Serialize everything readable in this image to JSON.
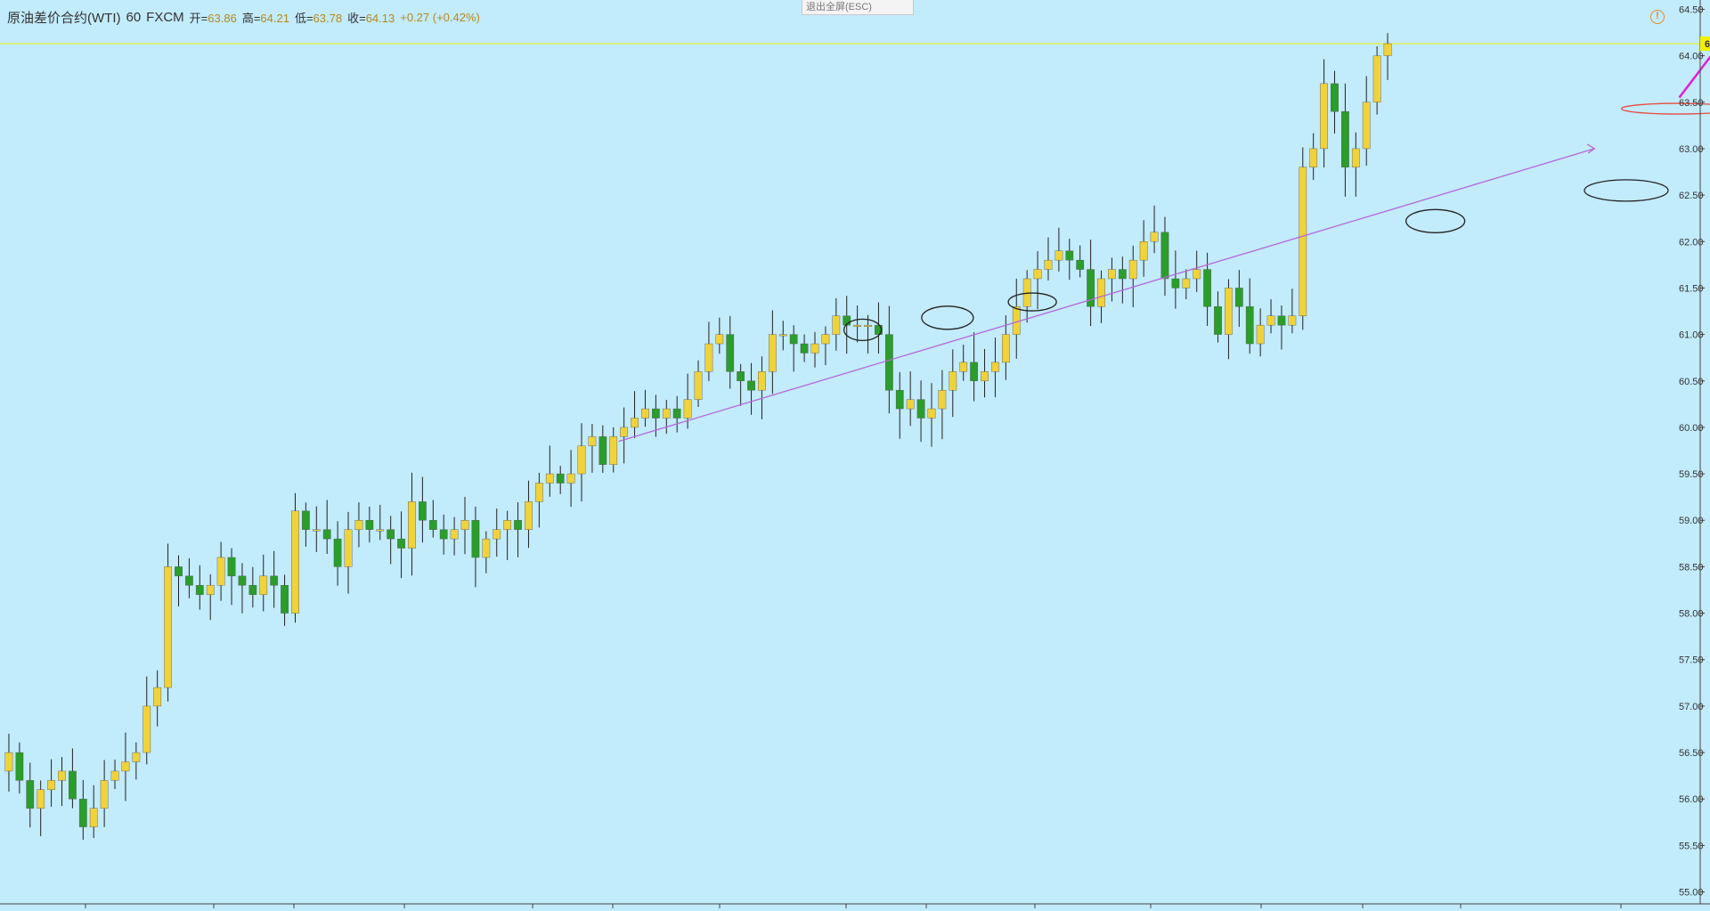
{
  "header": {
    "symbol": "原油差价合约(WTI)",
    "interval": "60",
    "exchange": "FXCM",
    "open_label": "开=",
    "open_value": "63.86",
    "high_label": "高=",
    "high_value": "64.21",
    "low_label": "低=",
    "low_value": "63.78",
    "close_label": "收=",
    "close_value": "64.13",
    "change": "+0.27 (+0.42%)"
  },
  "toolbar": {
    "exit_fullscreen": "退出全屏(ESC)"
  },
  "icons": {
    "alert": "warning-circle-icon"
  },
  "chart_data": {
    "type": "candlestick",
    "ylim": [
      54.9,
      64.6
    ],
    "y_ticks": [
      "64.50",
      "64.00",
      "63.50",
      "63.00",
      "62.50",
      "62.00",
      "61.50",
      "61.00",
      "60.50",
      "60.00",
      "59.50",
      "59.00",
      "58.50",
      "58.00",
      "57.50",
      "57.00",
      "56.50",
      "56.00",
      "55.50",
      "55.00"
    ],
    "last_price": "64.13",
    "colors": {
      "up": "#f0d23a",
      "down": "#2a9d2a",
      "wick": "#222222",
      "last_price_line": "#f3f000",
      "trendline": "#b667d8",
      "annotation_arrow": "#e51bd8",
      "circle": "#222222",
      "red_ellipse": "#e74c3c"
    },
    "closes": [
      56.5,
      56.2,
      55.9,
      56.1,
      56.2,
      56.3,
      56.0,
      55.7,
      55.9,
      56.2,
      56.3,
      56.4,
      56.5,
      57.0,
      57.2,
      58.5,
      58.4,
      58.3,
      58.2,
      58.3,
      58.6,
      58.4,
      58.3,
      58.2,
      58.4,
      58.3,
      58.0,
      59.1,
      58.9,
      58.9,
      58.8,
      58.5,
      58.9,
      59.0,
      58.9,
      58.9,
      58.8,
      58.7,
      59.2,
      59.0,
      58.9,
      58.8,
      58.9,
      59.0,
      58.6,
      58.8,
      58.9,
      59.0,
      58.9,
      59.2,
      59.4,
      59.5,
      59.4,
      59.5,
      59.8,
      59.9,
      59.6,
      59.9,
      60.0,
      60.1,
      60.2,
      60.1,
      60.2,
      60.1,
      60.3,
      60.6,
      60.9,
      61.0,
      60.6,
      60.5,
      60.4,
      60.6,
      61.0,
      61.0,
      60.9,
      60.8,
      60.9,
      61.0,
      61.2,
      61.1,
      61.1,
      61.1,
      61.0,
      60.4,
      60.2,
      60.3,
      60.1,
      60.2,
      60.4,
      60.6,
      60.7,
      60.5,
      60.6,
      60.7,
      61.0,
      61.3,
      61.6,
      61.7,
      61.8,
      61.9,
      61.8,
      61.7,
      61.3,
      61.6,
      61.7,
      61.6,
      61.8,
      62.0,
      62.1,
      61.6,
      61.5,
      61.6,
      61.7,
      61.3,
      61.0,
      61.5,
      61.3,
      60.9,
      61.1,
      61.2,
      61.1,
      61.2,
      62.8,
      63.0,
      63.7,
      63.4,
      62.8,
      63.0,
      63.5,
      64.0,
      64.13
    ],
    "annotations": {
      "trendline": {
        "from": [
          58,
          59.85
        ],
        "to": [
          150,
          63.0
        ]
      },
      "circles": [
        {
          "x": 81,
          "y": 61.05
        },
        {
          "x": 89,
          "y": 61.18
        },
        {
          "x": 97,
          "y": 61.35
        },
        {
          "x": 135,
          "y": 62.22
        },
        {
          "x": 153,
          "y": 62.55
        }
      ],
      "red_ellipse": {
        "x": 157,
        "y": 63.43
      },
      "arrow": {
        "from": [
          158,
          63.55
        ],
        "to": [
          163,
          64.3
        ]
      }
    }
  }
}
